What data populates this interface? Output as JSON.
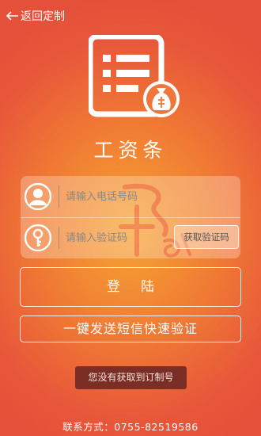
{
  "nav": {
    "back_label": "返回定制"
  },
  "app": {
    "title": "工资条"
  },
  "form": {
    "phone_placeholder": "请输入电话号码",
    "code_placeholder": "请输入验证码",
    "get_code_label": "获取验证码"
  },
  "actions": {
    "login_label": "登陆",
    "sms_verify_label": "一键发送短信快速验证",
    "no_code_label": "您没有获取到订制号"
  },
  "footer": {
    "contact": "联系方式：0755-82519586"
  },
  "icons": {
    "back": "arrow-left-icon",
    "logo": "payslip-document-icon",
    "phone_field": "user-avatar-icon",
    "code_field": "key-icon"
  },
  "colors": {
    "background_edge": "#e4503a",
    "background_center": "#f6a532",
    "dark_button": "#7a2e25",
    "text": "#ffffff"
  }
}
